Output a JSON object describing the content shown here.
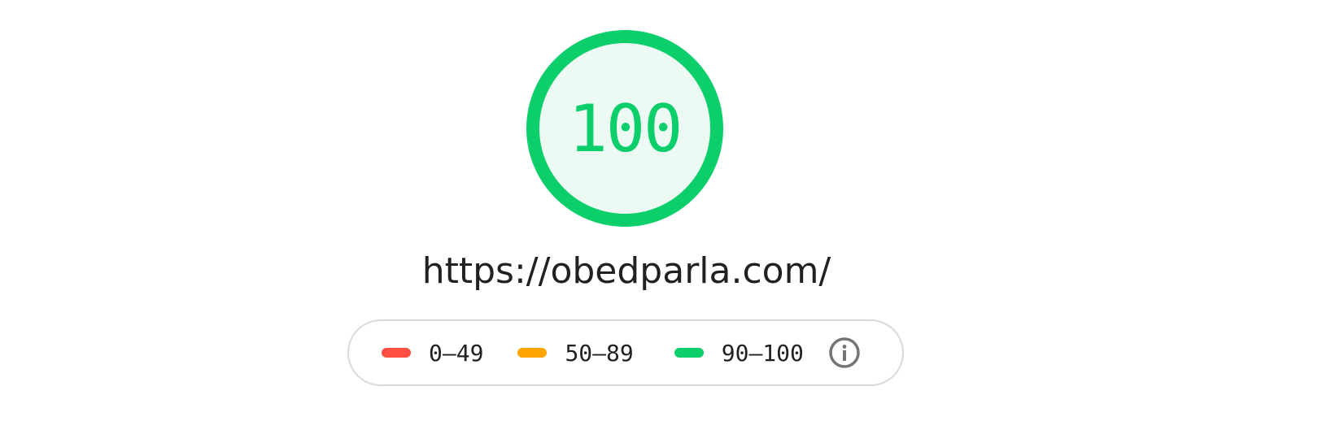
{
  "report": {
    "score": "100",
    "score_fraction": 1.0,
    "url": "https://obedparla.com/"
  },
  "legend": {
    "items": [
      {
        "label": "0–49",
        "color": "#ff4e42"
      },
      {
        "label": "50–89",
        "color": "#ffa400"
      },
      {
        "label": "90–100",
        "color": "#0cce6b"
      }
    ],
    "info_icon": "info-icon"
  },
  "colors": {
    "pass": "#0cce6b",
    "pass_fill": "#ecfaf3",
    "text": "#212121",
    "border": "#dadada",
    "icon": "#757575"
  }
}
